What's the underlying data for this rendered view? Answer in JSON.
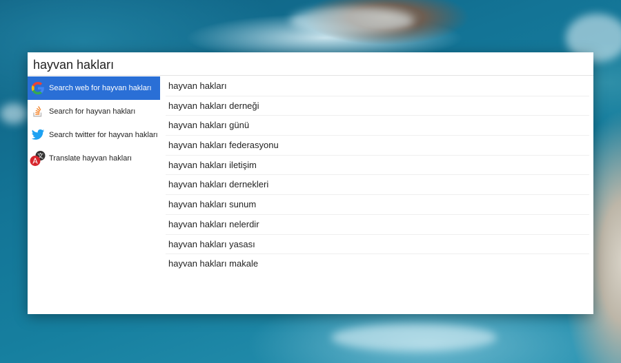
{
  "search": {
    "query": "hayvan hakları"
  },
  "actions": [
    {
      "label": "Search web for hayvan hakları",
      "icon": "google-icon",
      "selected": true
    },
    {
      "label": "Search for hayvan hakları",
      "icon": "stackoverflow-icon",
      "selected": false
    },
    {
      "label": "Search twitter for hayvan hakları",
      "icon": "twitter-icon",
      "selected": false
    },
    {
      "label": "Translate hayvan hakları",
      "icon": "translate-icon",
      "selected": false
    }
  ],
  "suggestions": [
    "hayvan hakları",
    "hayvan hakları derneği",
    "hayvan hakları günü",
    "hayvan hakları federasyonu",
    "hayvan hakları iletişim",
    "hayvan hakları dernekleri",
    "hayvan hakları sunum",
    "hayvan hakları nelerdir",
    "hayvan hakları yasası",
    "hayvan hakları makale"
  ],
  "colors": {
    "selected_bg": "#2a6fd6",
    "twitter": "#1da1f2",
    "stackoverflow": "#f48024",
    "translate_red": "#d6262d"
  }
}
